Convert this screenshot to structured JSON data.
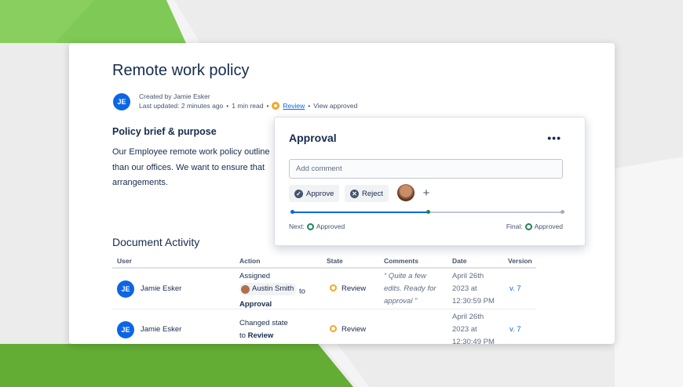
{
  "page": {
    "title": "Remote work policy",
    "author_initials": "JE",
    "created_by": "Created by Jamie Esker",
    "last_updated": "Last updated: 2 minutes ago",
    "read_time": "1 min read",
    "status": "Review",
    "view_approved": "View approved",
    "section_heading": "Policy brief & purpose",
    "paragraph_lines": [
      "Our Employee remote work policy outline",
      "than our offices. We want to ensure that",
      "arrangements."
    ]
  },
  "activity": {
    "heading": "Document Activity",
    "columns": [
      "User",
      "Action",
      "State",
      "Comments",
      "Date",
      "Version"
    ],
    "rows": [
      {
        "initials": "JE",
        "user": "Jamie Esker",
        "action_line1": "Assigned",
        "mention": "Austin Smith",
        "action_to": "to",
        "action_bold": "Approval",
        "state": "Review",
        "comment_lines": [
          "“ Quite a few",
          "edits. Ready for",
          "approval ”"
        ],
        "date_lines": [
          "April 26th",
          "2023 at",
          "12:30:59 PM"
        ],
        "version": "v. 7"
      },
      {
        "initials": "JE",
        "user": "Jamie Esker",
        "action_line1": "Changed state",
        "action_line2_prefix": "to",
        "action_bold": "Review",
        "state": "Review",
        "date_lines": [
          "April 26th",
          "2023 at",
          "12:30:49 PM"
        ],
        "version": "v. 7"
      }
    ]
  },
  "approval": {
    "title": "Approval",
    "more": "•••",
    "comment_placeholder": "Add comment",
    "approve_label": "Approve",
    "reject_label": "Reject",
    "add": "+",
    "progress": 0.5,
    "next_prefix": "Next:",
    "next_state": "Approved",
    "final_prefix": "Final:",
    "final_state": "Approved"
  },
  "colors": {
    "accent": "#0c66e4",
    "review": "#f5a623",
    "approved": "#1f845a",
    "background_green": "#6cb33f"
  }
}
